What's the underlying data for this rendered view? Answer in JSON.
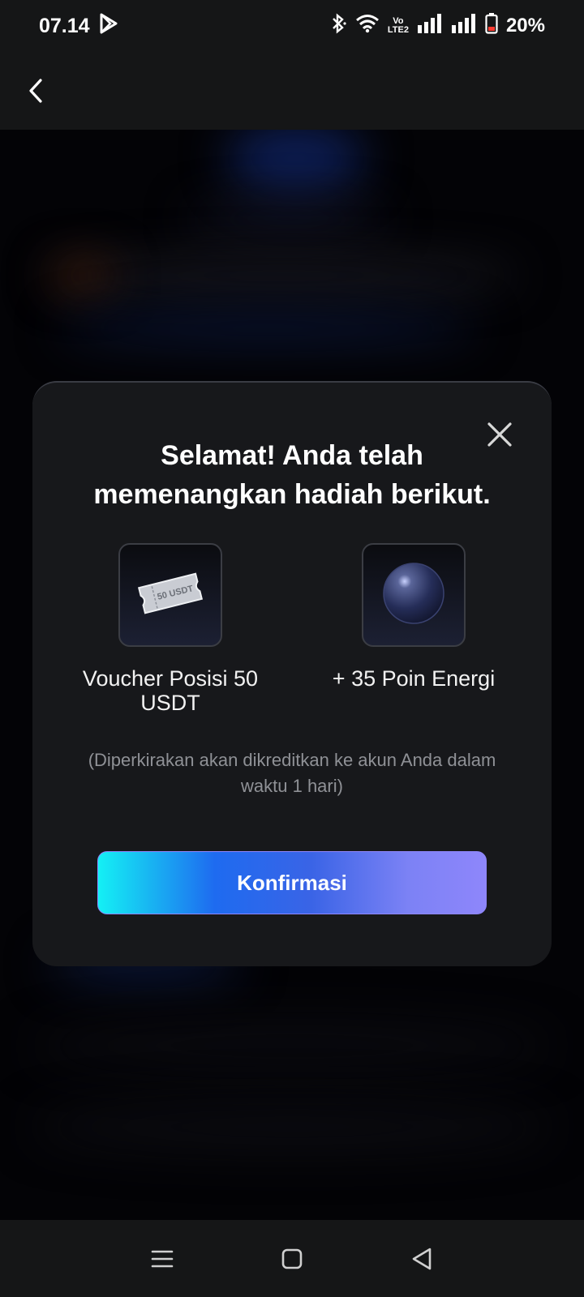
{
  "status_bar": {
    "time": "07.14",
    "network_label_top": "Vo",
    "network_label_bottom": "LTE2",
    "battery_percent": "20%",
    "icons": [
      "play-store-icon",
      "bluetooth-icon",
      "wifi-icon",
      "volte-icon",
      "signal-icon",
      "signal-icon",
      "battery-icon"
    ]
  },
  "header": {
    "back_icon": "chevron-left-icon"
  },
  "modal": {
    "title": "Selamat! Anda telah memenangkan hadiah berikut.",
    "rewards": [
      {
        "label": "Voucher Posisi 50 USDT",
        "icon": "voucher-ticket-icon",
        "ticket_text": "50 USDT"
      },
      {
        "label": "+ 35 Poin Energi",
        "icon": "energy-orb-icon"
      }
    ],
    "note": "(Diperkirakan akan dikreditkan ke akun Anda dalam waktu 1 hari)",
    "confirm_label": "Konfirmasi",
    "close_icon": "close-icon"
  },
  "nav_bar": {
    "icons": [
      "menu-icon",
      "home-icon",
      "back-icon"
    ]
  },
  "colors": {
    "modal_bg": "#17181b",
    "button_start": "#14f0f4",
    "button_mid": "#1e6bf0",
    "button_end": "#8e86fb",
    "note_text": "#8f9196"
  }
}
